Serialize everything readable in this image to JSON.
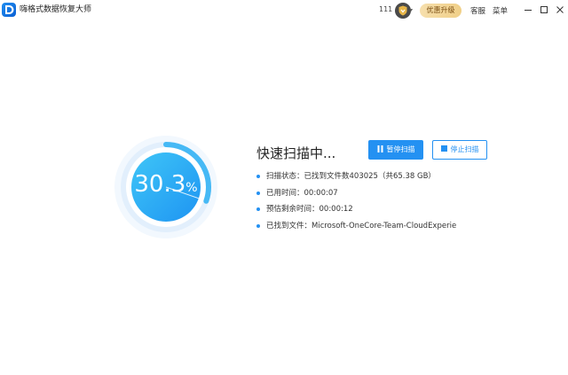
{
  "app": {
    "title": "嗨格式数据恢复大师",
    "brand_color": "#1f8ef1"
  },
  "header": {
    "count": "111",
    "vip_icon": "vip-shield-icon",
    "upgrade_label": "优惠升级",
    "service_label": "客服",
    "menu_label": "菜单"
  },
  "window": {
    "minimize_icon": "minimize-icon",
    "maximize_icon": "maximize-icon",
    "close_icon": "close-icon"
  },
  "progress": {
    "value": "30.3",
    "unit": "%",
    "fraction": 0.303
  },
  "scan": {
    "title": "快速扫描中...",
    "pause_label": "暂停扫描",
    "stop_label": "停止扫描",
    "info": [
      "扫描状态：已找到文件数403025（共65.38 GB）",
      "已用时间：00:00:07",
      "预估剩余时间：00:00:12",
      "已找到文件：Microsoft-OneCore-Team-CloudExperie"
    ]
  }
}
